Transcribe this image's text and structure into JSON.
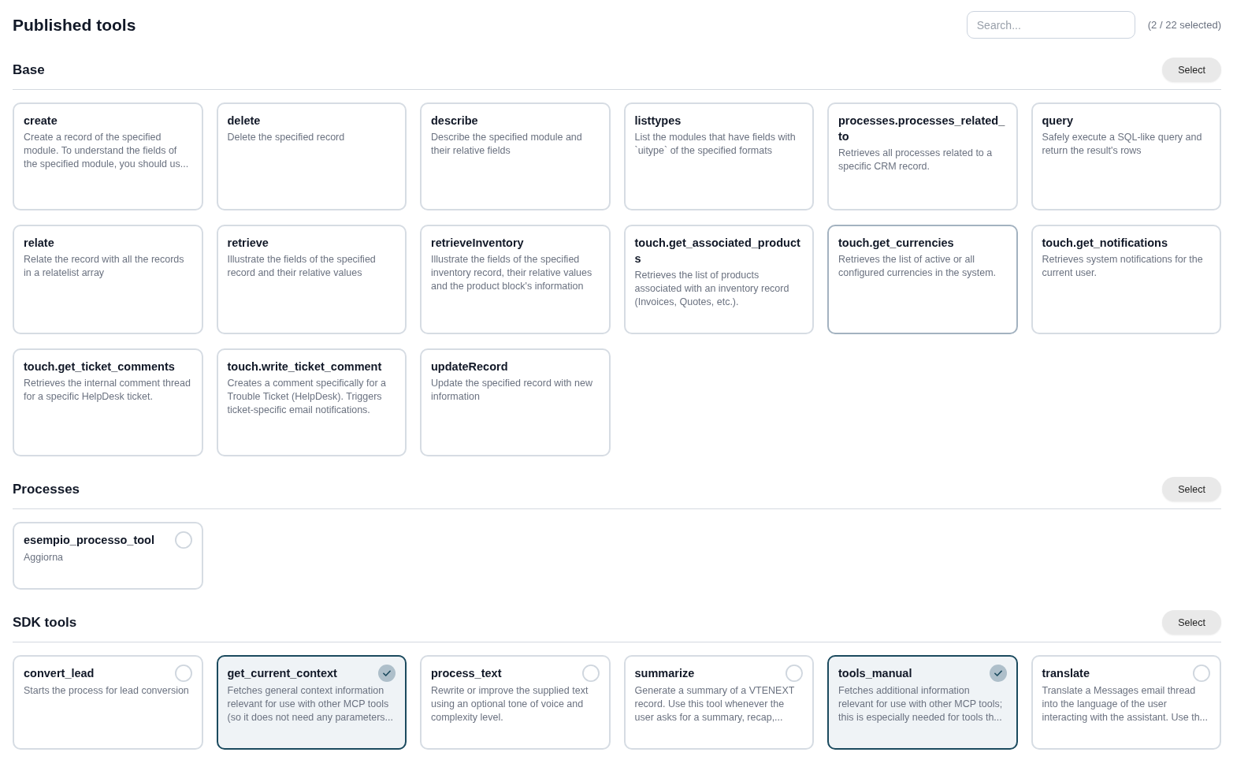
{
  "page": {
    "title": "Published tools"
  },
  "search": {
    "placeholder": "Search..."
  },
  "selection_count": "(2 / 22 selected)",
  "sections": [
    {
      "title": "Base",
      "select_label": "Select",
      "tools": [
        {
          "kind": "plain",
          "name": "create",
          "description": "Create a record of the specified module. To understand the fields of the specified module, you should us...",
          "hovered": false
        },
        {
          "kind": "plain",
          "name": "delete",
          "description": "Delete the specified record",
          "hovered": false
        },
        {
          "kind": "plain",
          "name": "describe",
          "description": "Describe the specified module and their relative fields",
          "hovered": false
        },
        {
          "kind": "plain",
          "name": "listtypes",
          "description": "List the modules that have fields with `uitype` of the specified formats",
          "hovered": false
        },
        {
          "kind": "plain",
          "name": "processes.processes_related_to",
          "description": "Retrieves all processes related to a specific CRM record.",
          "hovered": false
        },
        {
          "kind": "plain",
          "name": "query",
          "description": "Safely execute a SQL-like query and return the result's rows",
          "hovered": false
        },
        {
          "kind": "plain",
          "name": "relate",
          "description": "Relate the record with all the records in a relatelist array",
          "hovered": false
        },
        {
          "kind": "plain",
          "name": "retrieve",
          "description": "Illustrate the fields of the specified record and their relative values",
          "hovered": false
        },
        {
          "kind": "plain",
          "name": "retrieveInventory",
          "description": "Illustrate the fields of the specified inventory record, their relative values and the product block's information",
          "hovered": false
        },
        {
          "kind": "plain",
          "name": "touch.get_associated_products",
          "description": "Retrieves the list of products associated with an inventory record (Invoices, Quotes, etc.).",
          "hovered": false
        },
        {
          "kind": "plain",
          "name": "touch.get_currencies",
          "description": "Retrieves the list of active or all configured currencies in the system.",
          "hovered": true
        },
        {
          "kind": "plain",
          "name": "touch.get_notifications",
          "description": "Retrieves system notifications for the current user.",
          "hovered": false
        },
        {
          "kind": "plain",
          "name": "touch.get_ticket_comments",
          "description": "Retrieves the internal comment thread for a specific HelpDesk ticket.",
          "hovered": false
        },
        {
          "kind": "plain",
          "name": "touch.write_ticket_comment",
          "description": "Creates a comment specifically for a Trouble Ticket (HelpDesk). Triggers ticket-specific email notifications.",
          "hovered": false
        },
        {
          "kind": "plain",
          "name": "updateRecord",
          "description": "Update the specified record with new information",
          "hovered": false
        }
      ]
    },
    {
      "title": "Processes",
      "select_label": "Select",
      "tools": [
        {
          "kind": "selectable",
          "name": "esempio_processo_tool",
          "description": "Aggiorna",
          "selected": false
        }
      ]
    },
    {
      "title": "SDK tools",
      "select_label": "Select",
      "tools": [
        {
          "kind": "selectable",
          "name": "convert_lead",
          "description": "Starts the process for lead conversion",
          "selected": false
        },
        {
          "kind": "selectable",
          "name": "get_current_context",
          "description": "Fetches general context information relevant for use with other MCP tools (so it does not need any parameters...",
          "selected": true
        },
        {
          "kind": "selectable",
          "name": "process_text",
          "description": "Rewrite or improve the supplied text using an optional tone of voice and complexity level.",
          "selected": false
        },
        {
          "kind": "selectable",
          "name": "summarize",
          "description": "Generate a summary of a VTENEXT record. Use this tool whenever the user asks for a summary, recap,...",
          "selected": false
        },
        {
          "kind": "selectable",
          "name": "tools_manual",
          "description": "Fetches additional information relevant for use with other MCP tools; this is especially needed for tools th...",
          "selected": true
        },
        {
          "kind": "selectable",
          "name": "translate",
          "description": "Translate a Messages email thread into the language of the user interacting with the assistant. Use th...",
          "selected": false
        }
      ]
    }
  ]
}
